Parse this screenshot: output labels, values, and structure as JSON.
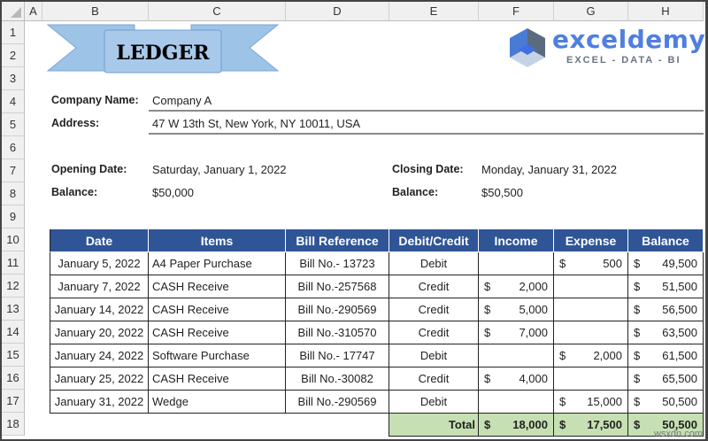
{
  "sheet": {
    "columns": [
      "A",
      "B",
      "C",
      "D",
      "E",
      "F",
      "G",
      "H"
    ],
    "rows": [
      "1",
      "2",
      "3",
      "4",
      "5",
      "6",
      "7",
      "8",
      "9",
      "10",
      "11",
      "12",
      "13",
      "14",
      "15",
      "16",
      "17",
      "18"
    ]
  },
  "banner": {
    "title": "LEDGER"
  },
  "logo": {
    "name": "exceldemy",
    "tagline": "EXCEL - DATA - BI"
  },
  "info": {
    "company_label": "Company Name:",
    "company": "Company A",
    "address_label": "Address:",
    "address": "47 W 13th St, New York, NY 10011, USA",
    "opening_label": "Opening Date:",
    "opening": "Saturday, January 1, 2022",
    "closing_label": "Closing Date:",
    "closing": "Monday, January 31, 2022",
    "open_balance_label": "Balance:",
    "open_balance": "$50,000",
    "close_balance_label": "Balance:",
    "close_balance": "$50,500"
  },
  "table": {
    "headers": [
      "Date",
      "Items",
      "Bill Reference",
      "Debit/Credit",
      "Income",
      "Expense",
      "Balance"
    ],
    "rows": [
      [
        "January 5, 2022",
        "A4 Paper Purchase",
        "Bill No.- 13723",
        "Debit",
        "",
        "500",
        "49,500"
      ],
      [
        "January 7, 2022",
        "CASH Receive",
        "Bill No.-257568",
        "Credit",
        "2,000",
        "",
        "51,500"
      ],
      [
        "January 14, 2022",
        "CASH Receive",
        "Bill No.-290569",
        "Credit",
        "5,000",
        "",
        "56,500"
      ],
      [
        "January 20, 2022",
        "CASH Receive",
        "Bill No.-310570",
        "Credit",
        "7,000",
        "",
        "63,500"
      ],
      [
        "January 24, 2022",
        "Software Purchase",
        "Bill No.- 17747",
        "Debit",
        "",
        "2,000",
        "61,500"
      ],
      [
        "January 25, 2022",
        "CASH Receive",
        "Bill No.-30082",
        "Credit",
        "4,000",
        "",
        "65,500"
      ],
      [
        "January 31, 2022",
        "Wedge",
        "Bill No.-290569",
        "Debit",
        "",
        "15,000",
        "50,500"
      ]
    ],
    "currency": "$",
    "total_label": "Total",
    "total": [
      "18,000",
      "17,500",
      "50,500"
    ]
  },
  "watermark": "wsxdn.com"
}
